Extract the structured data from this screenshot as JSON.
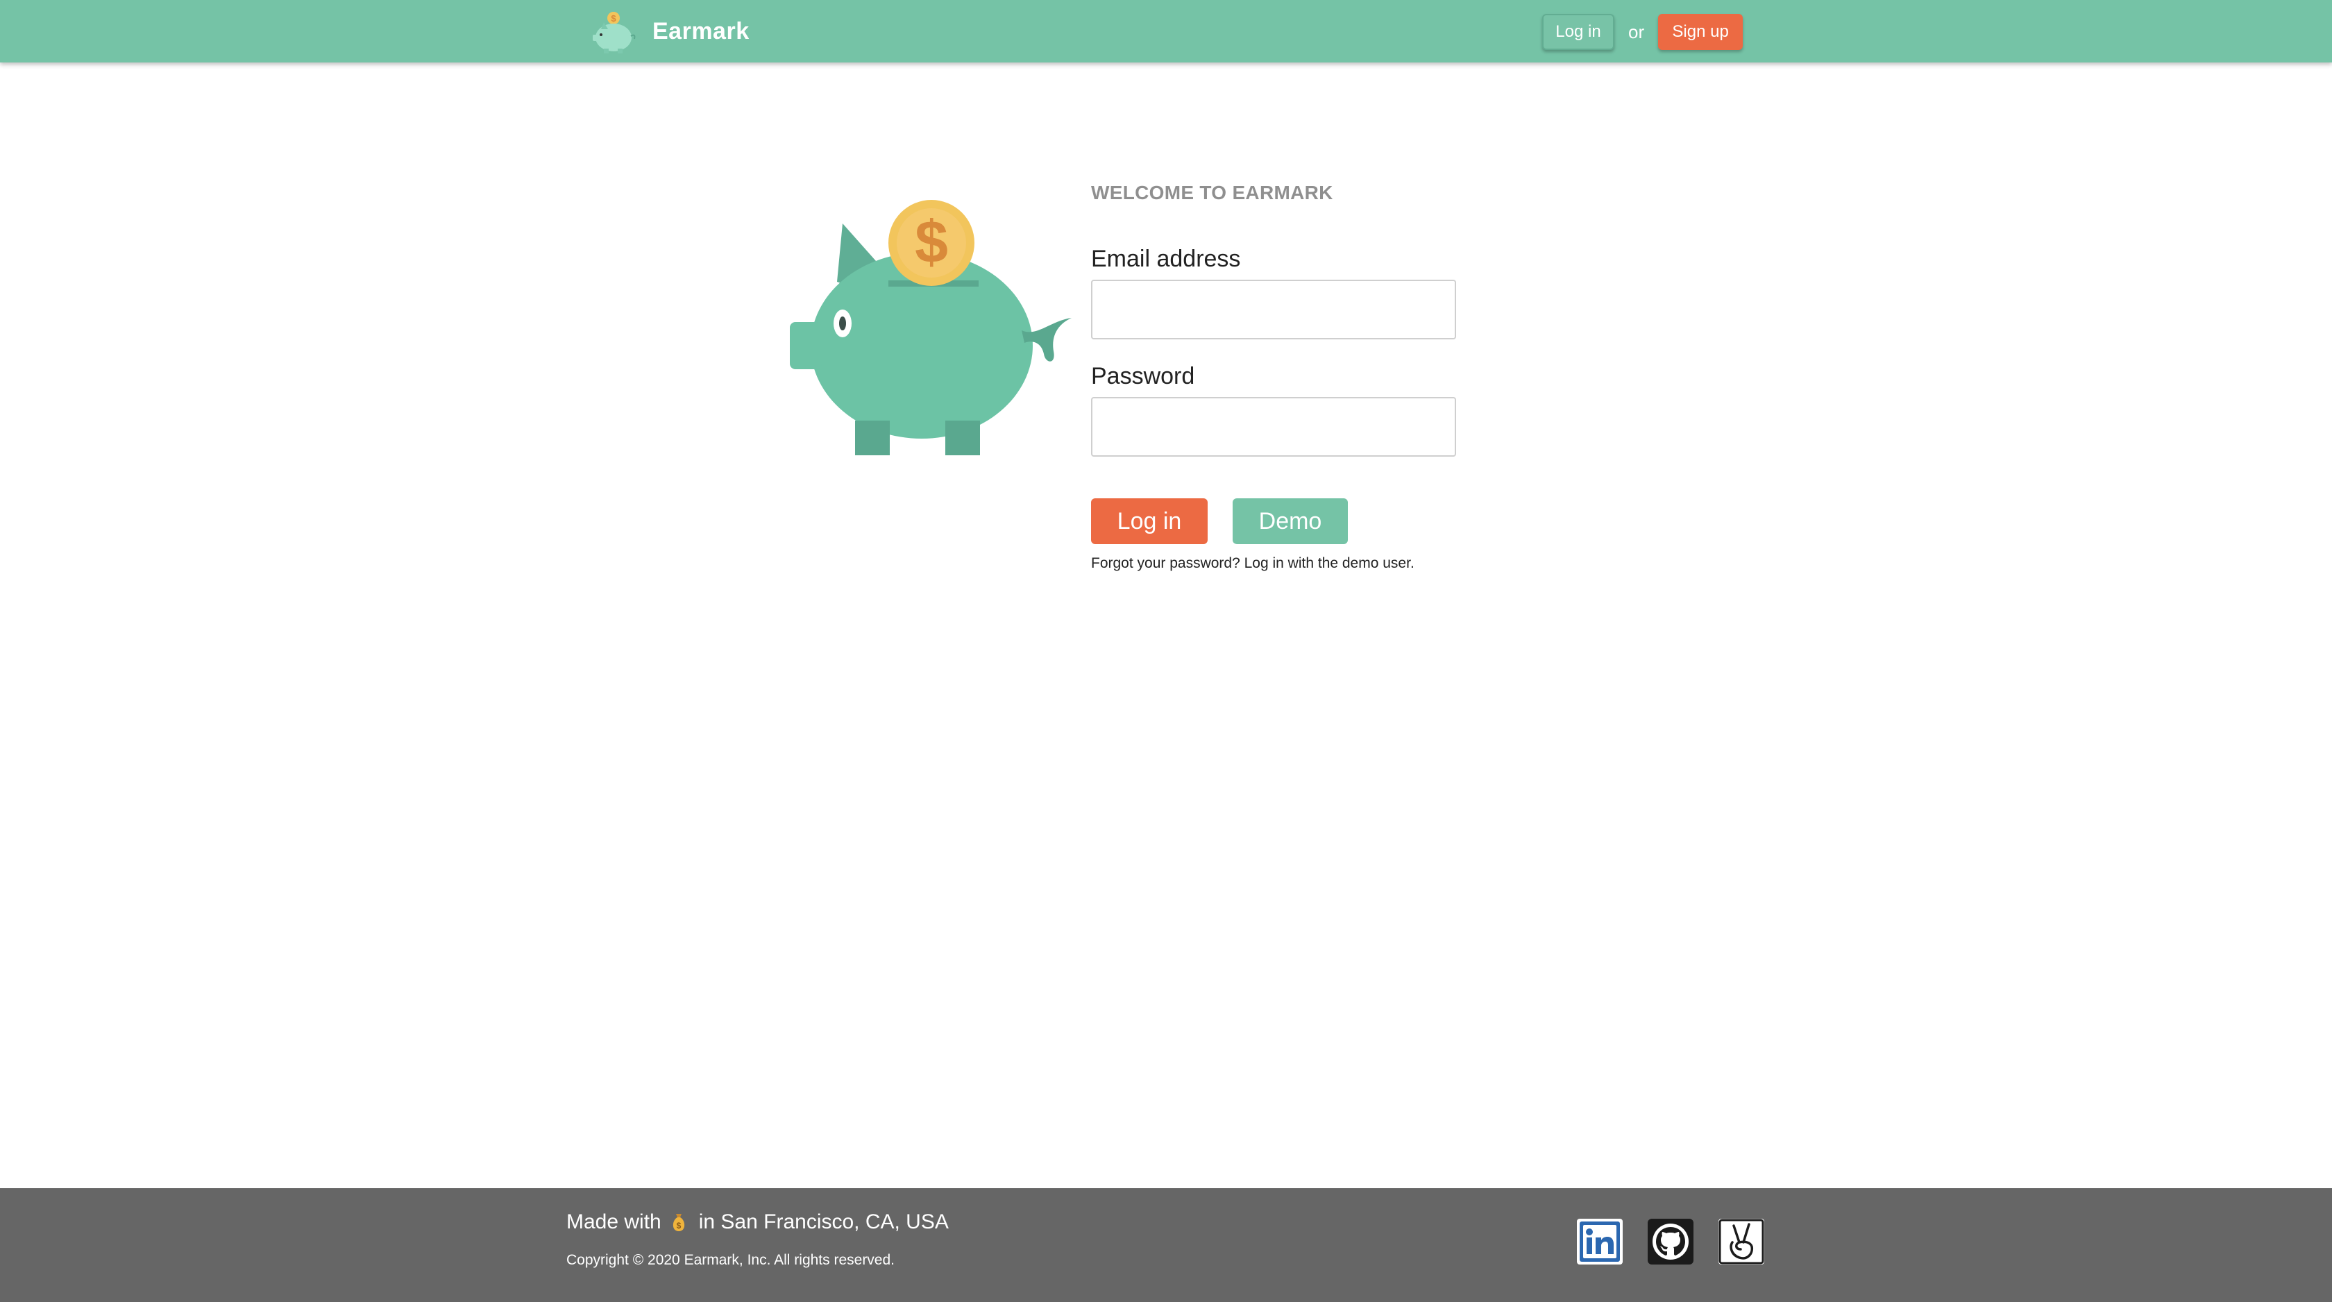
{
  "app": {
    "brand_name": "Earmark",
    "accent_color": "#75c3a6",
    "cta_color": "#ec6a43",
    "footer_color": "#666666"
  },
  "nav": {
    "login_label": "Log in",
    "or_text": "or",
    "signup_label": "Sign up"
  },
  "login_form": {
    "welcome": "WELCOME TO EARMARK",
    "email_label": "Email address",
    "email_value": "",
    "password_label": "Password",
    "password_value": "",
    "login_button": "Log in",
    "demo_button": "Demo",
    "forgot_link": "Forgot your password?",
    "demo_link": "Log in with the demo user."
  },
  "footer": {
    "made_with_prefix": "Made with",
    "made_with_icon": "money-bag-icon",
    "made_with_suffix": "in San Francisco, CA, USA",
    "copyright": "Copyright © 2020 Earmark, Inc. All rights reserved.",
    "social_icons": [
      "linkedin-icon",
      "github-icon",
      "angellist-icon"
    ]
  }
}
